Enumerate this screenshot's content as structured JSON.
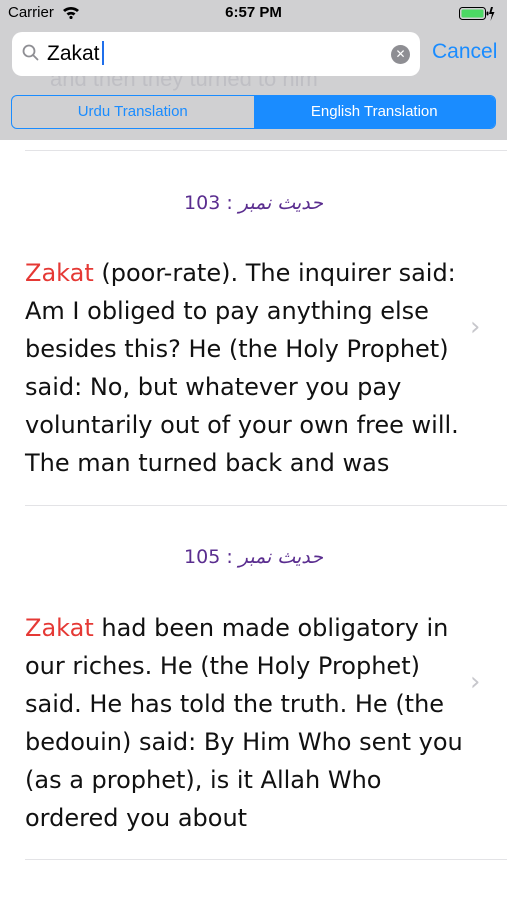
{
  "status_bar": {
    "carrier": "Carrier",
    "time": "6:57 PM"
  },
  "search": {
    "value": "Zakat",
    "ghost_text": "and then they turned to him",
    "cancel_label": "Cancel"
  },
  "segments": {
    "urdu": "Urdu Translation",
    "english": "English Translation",
    "selected": "English Translation"
  },
  "results": [
    {
      "number": "103 :",
      "urdu_label": "حدیث نمبر",
      "keyword": "Zakat",
      "text": " (poor-rate). The inquirer said: Am I obliged to pay anything else besides this? He (the Holy Prophet) said: No, but whatever you pay voluntarily out of your own free will. The man turned back and was"
    },
    {
      "number": "105 :",
      "urdu_label": "حدیث نمبر",
      "keyword": "Zakat",
      "text": " had been made obligatory in our riches. He (the Holy Prophet) said. He has told the truth. He (the bedouin) said: By Him Who sent you (as a prophet), is it Allah Who ordered you about"
    }
  ],
  "colors": {
    "accent": "#1a8cff",
    "keyword": "#e53935",
    "number": "#5a2d8f"
  }
}
